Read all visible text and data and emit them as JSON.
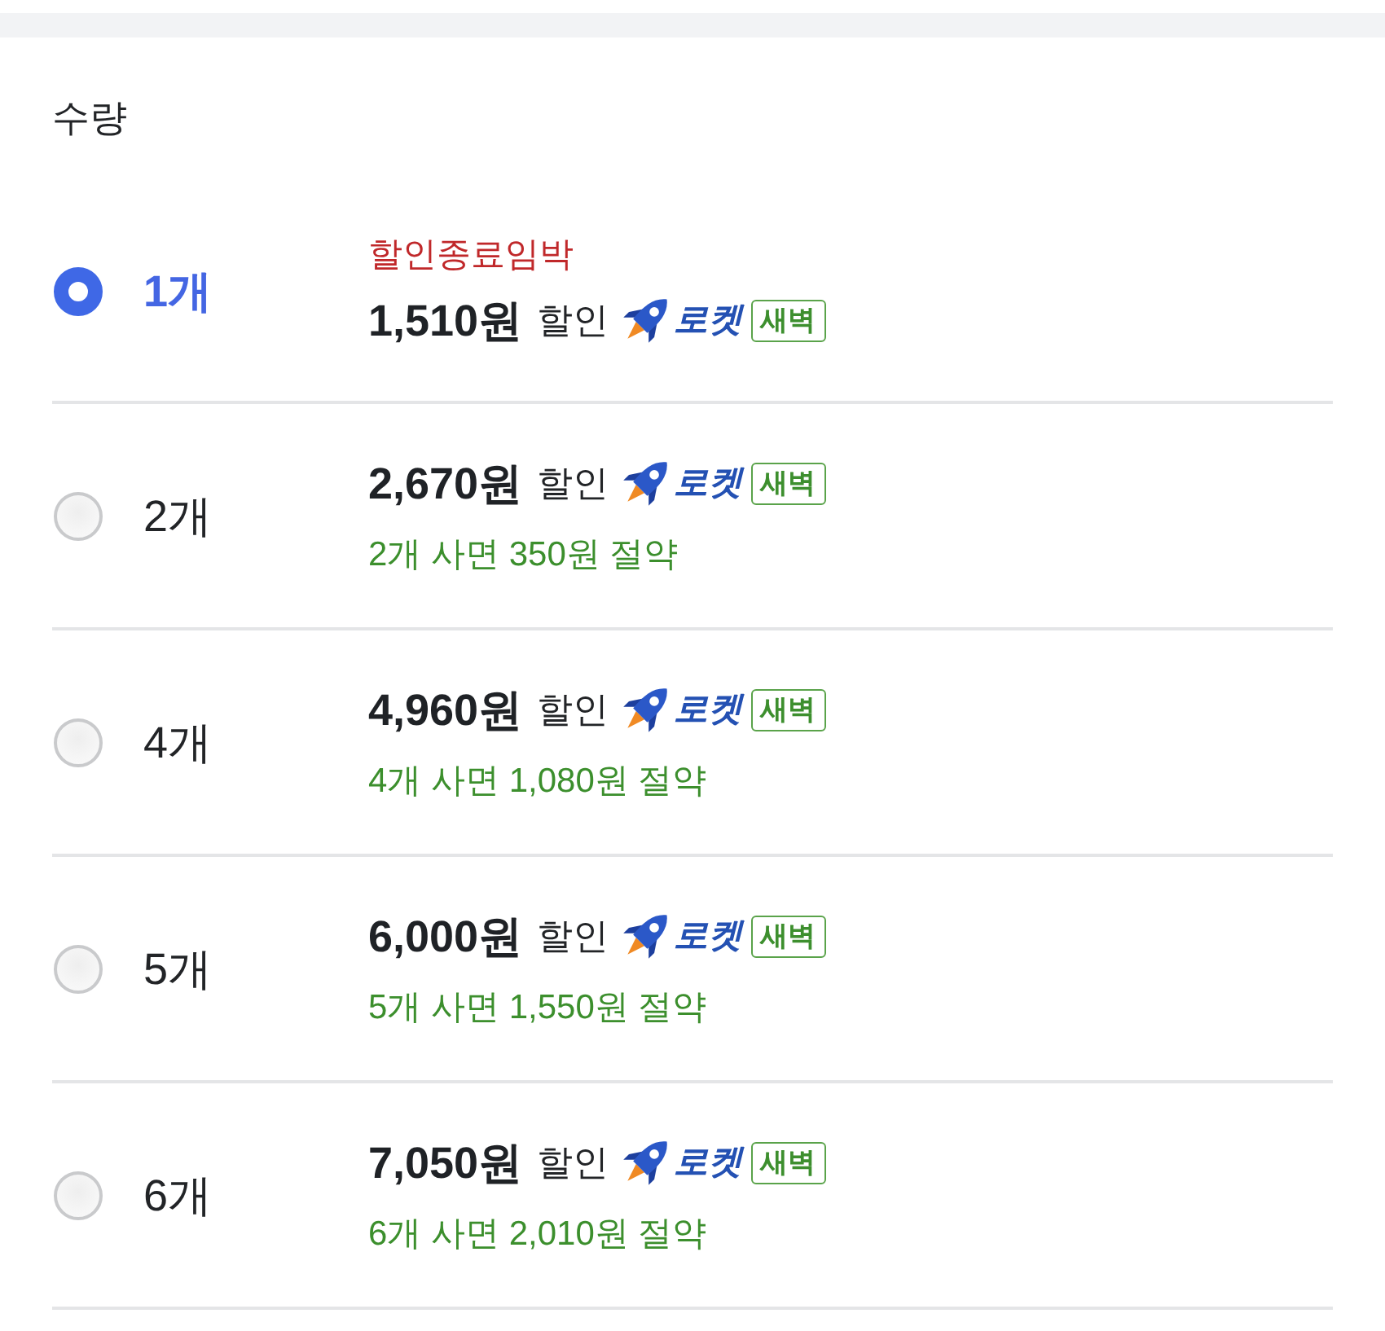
{
  "section_title": "수량",
  "options": [
    {
      "quantity": "1개",
      "selected": true,
      "urgency": "할인종료임박",
      "price": "1,510원",
      "price_suffix": "할인",
      "delivery": "로켓",
      "delivery_tag": "새벽"
    },
    {
      "quantity": "2개",
      "selected": false,
      "price": "2,670원",
      "price_suffix": "할인",
      "delivery": "로켓",
      "delivery_tag": "새벽",
      "savings": "2개 사면 350원 절약"
    },
    {
      "quantity": "4개",
      "selected": false,
      "price": "4,960원",
      "price_suffix": "할인",
      "delivery": "로켓",
      "delivery_tag": "새벽",
      "savings": "4개 사면 1,080원 절약"
    },
    {
      "quantity": "5개",
      "selected": false,
      "price": "6,000원",
      "price_suffix": "할인",
      "delivery": "로켓",
      "delivery_tag": "새벽",
      "savings": "5개 사면 1,550원 절약"
    },
    {
      "quantity": "6개",
      "selected": false,
      "price": "7,050원",
      "price_suffix": "할인",
      "delivery": "로켓",
      "delivery_tag": "새벽",
      "savings": "6개 사면 2,010원 절약"
    }
  ]
}
